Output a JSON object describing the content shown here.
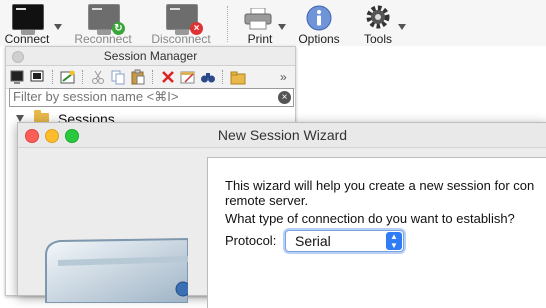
{
  "toolbar": {
    "connect": "Connect",
    "reconnect": "Reconnect",
    "disconnect": "Disconnect",
    "print": "Print",
    "options": "Options",
    "tools": "Tools"
  },
  "session_manager": {
    "title": "Session Manager",
    "filter_placeholder": "Filter by session name <⌘I>",
    "tree": [
      {
        "label": "Sessions",
        "expanded": true
      }
    ]
  },
  "wizard": {
    "title": "New Session Wizard",
    "intro_line1": "This wizard will help you create a new session for con",
    "intro_line2": "remote server.",
    "question": "What type of connection do you want to establish?",
    "protocol_label": "Protocol:",
    "protocol_value": "Serial"
  },
  "colors": {
    "accent": "#2f7cf6",
    "folder": "#e8b84a"
  }
}
